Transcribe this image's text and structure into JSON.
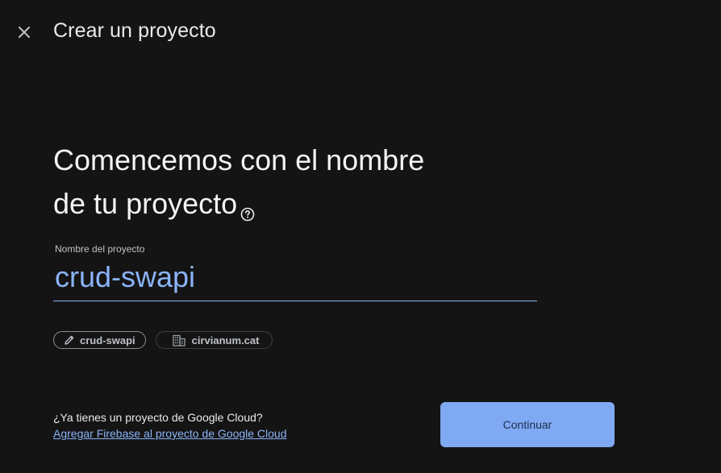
{
  "topbar": {
    "close_icon": "close-icon",
    "title": "Crear un proyecto"
  },
  "heading": {
    "line1": "Comencemos con el nombre",
    "line2": "de tu proyecto",
    "help_icon": "help-circle-icon"
  },
  "project_name_field": {
    "label": "Nombre del proyecto",
    "value": "crud-swapi"
  },
  "chips": [
    {
      "icon": "pencil-icon",
      "label": "crud-swapi"
    },
    {
      "icon": "organization-icon",
      "label": "cirvianum.cat"
    }
  ],
  "footer": {
    "question": "¿Ya tienes un proyecto de Google Cloud?",
    "link": "Agregar Firebase al proyecto de Google Cloud"
  },
  "continue_button": {
    "label": "Continuar"
  },
  "colors": {
    "background": "#141414",
    "accent": "#8ab4f8",
    "button_bg": "#7fa9f3"
  }
}
